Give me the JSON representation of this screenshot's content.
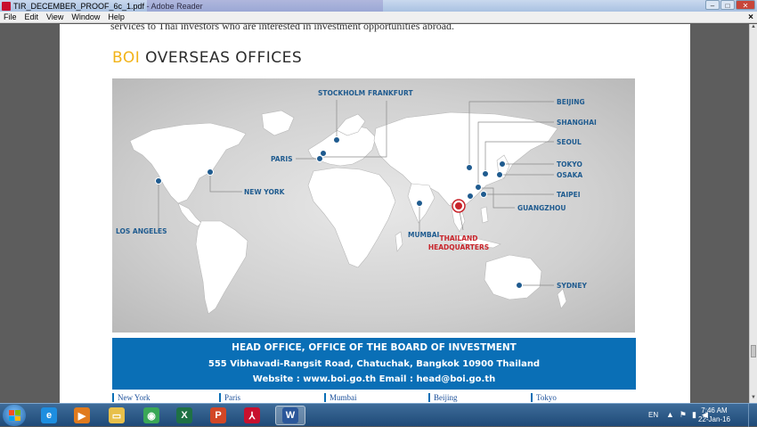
{
  "window": {
    "title": "TIR_DECEMBER_PROOF_6c_1.pdf - Adobe Reader",
    "controls": {
      "minimize": "–",
      "maximize": "□",
      "close": "✕"
    }
  },
  "menu": {
    "items": [
      "File",
      "Edit",
      "View",
      "Window",
      "Help"
    ],
    "doc_close": "×"
  },
  "document": {
    "intro_text": "services to Thai investors who are interested in investment opportunities abroad.",
    "heading_accent": "BOI",
    "heading_rest": "OVERSEAS OFFICES",
    "map_labels": {
      "stockholm": "STOCKHOLM",
      "frankfurt": "FRANKFURT",
      "paris": "PARIS",
      "new_york": "NEW YORK",
      "los_angeles": "LOS ANGELES",
      "mumbai": "MUMBAI",
      "beijing": "BEIJING",
      "shanghai": "SHANGHAI",
      "seoul": "SEOUL",
      "tokyo": "TOKYO",
      "osaka": "OSAKA",
      "taipei": "TAIPEI",
      "guangzhou": "GUANGZHOU",
      "hq_line1": "THAILAND",
      "hq_line2": "HEADQUARTERS",
      "sydney": "SYDNEY"
    },
    "info": {
      "line1": "HEAD OFFICE, OFFICE OF THE BOARD OF INVESTMENT",
      "line2": "555 Vibhavadi-Rangsit Road, Chatuchak, Bangkok 10900 Thailand",
      "line3": "Website : www.boi.go.th  Email : head@boi.go.th"
    },
    "city_columns": [
      "New York",
      "Paris",
      "Mumbai",
      "Beijing",
      "Tokyo"
    ]
  },
  "taskbar": {
    "apps": [
      {
        "name": "internet-explorer",
        "glyph": "e",
        "color": "#1d8ee0"
      },
      {
        "name": "media-player",
        "glyph": "▶",
        "color": "#e07a1d"
      },
      {
        "name": "file-explorer",
        "glyph": "▭",
        "color": "#e8c04a"
      },
      {
        "name": "chrome",
        "glyph": "◉",
        "color": "#3aa757"
      },
      {
        "name": "excel",
        "glyph": "X",
        "color": "#1e7145"
      },
      {
        "name": "powerpoint",
        "glyph": "P",
        "color": "#d24726"
      },
      {
        "name": "adobe-reader",
        "glyph": "⅄",
        "color": "#c8102e"
      },
      {
        "name": "word",
        "glyph": "W",
        "color": "#2b579a"
      }
    ],
    "language": "EN",
    "time": "7:46 AM",
    "date": "22-Jan-16"
  },
  "colors": {
    "accent_yellow": "#f2b318",
    "info_blue": "#0a6fb6",
    "pin_blue": "#1f5b8f",
    "hq_red": "#c8242b"
  }
}
